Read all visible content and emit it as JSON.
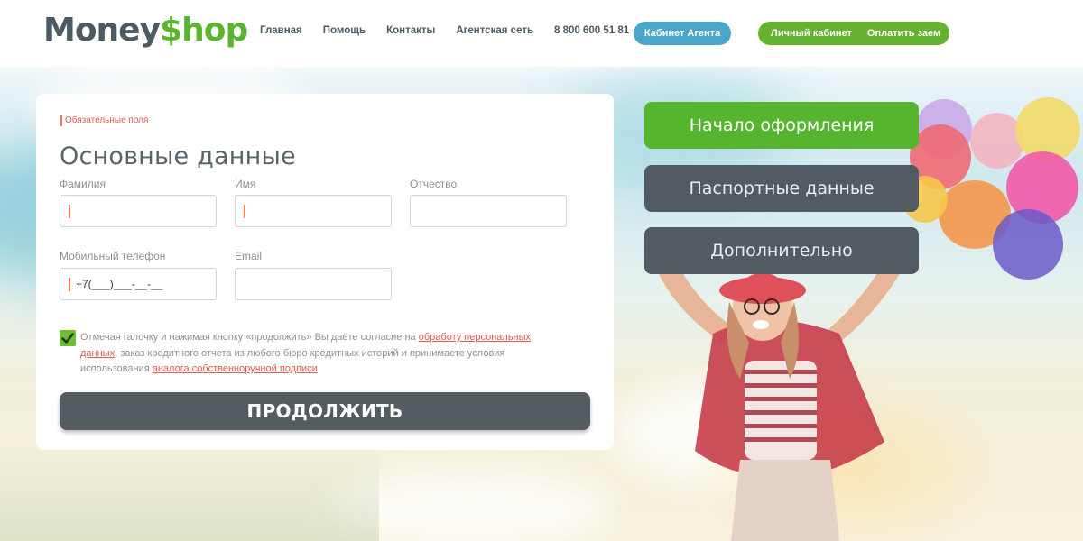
{
  "brand": {
    "logo_money": "Money",
    "logo_dollar": "$",
    "logo_shop": "hop",
    "colors": {
      "green": "#5ab52e",
      "gray": "#4b5a63",
      "blue": "#4aa6c9",
      "accent_red": "#e05a4f"
    }
  },
  "nav": {
    "items": [
      "Главная",
      "Помощь",
      "Контакты",
      "Агентская сеть"
    ],
    "phone": "8 800 600 51 81",
    "agent_button": "Кабинет Агента",
    "personal_cabinet": "Личный кабинет",
    "pay_loan": "Оплатить заем"
  },
  "form": {
    "required_note": "Обязательные поля",
    "title": "Основные данные",
    "labels": {
      "last_name": "Фамилия",
      "first_name": "Имя",
      "patronymic": "Отчество",
      "phone": "Мобильный телефон",
      "email": "Email"
    },
    "values": {
      "phone": "+7(___)___-__-__"
    },
    "consent": {
      "checked": true,
      "text_1": "Отмечая галочку и нажимая кнопку «продолжить» Вы даёте согласие на ",
      "link_1": "обработу персональных данных",
      "text_2": ", заказ кредитного отчета из любого бюро кредитных историй и принимаете условия использования ",
      "link_2": "аналога собственноручной подписи"
    },
    "continue_button": "ПРОДОЛЖИТЬ"
  },
  "steps": [
    {
      "label": "Начало оформления",
      "active": true
    },
    {
      "label": "Паспортные данные",
      "active": false
    },
    {
      "label": "Дополнительно",
      "active": false
    }
  ],
  "icons": [
    "check-icon"
  ]
}
